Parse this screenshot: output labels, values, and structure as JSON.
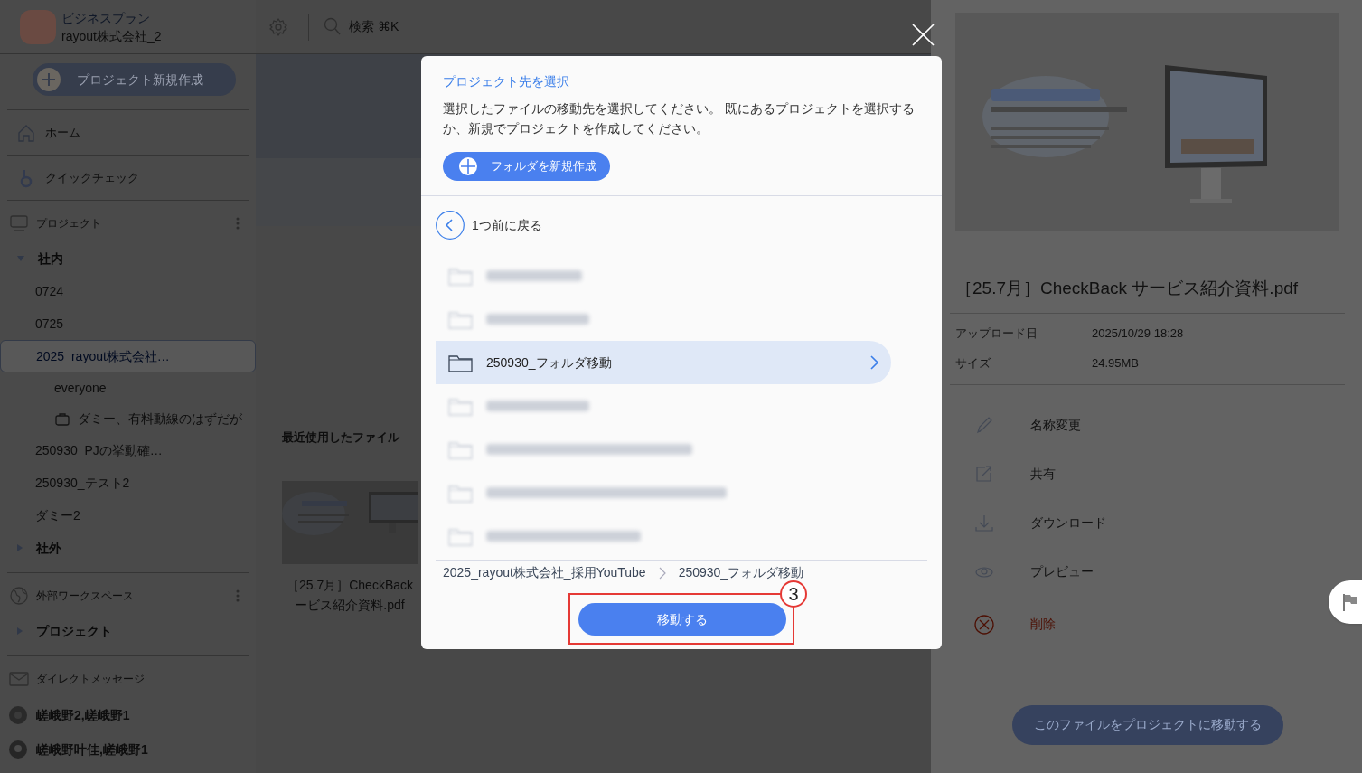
{
  "header": {
    "plan": "ビジネスプラン",
    "workspace": "rayout株式会社_2",
    "search": {
      "placeholder": "検索 ⌘K"
    }
  },
  "sidebar": {
    "new_project_button": "プロジェクト新規作成",
    "nav": [
      {
        "label": "ホーム",
        "kind": "home"
      },
      {
        "label": "クイックチェック",
        "kind": "quick"
      }
    ],
    "projects": {
      "title": "プロジェクト",
      "groups": [
        {
          "label": "社内",
          "expanded": true,
          "children": [
            {
              "label": "0724",
              "selected": false
            },
            {
              "label": "0725",
              "selected": false
            },
            {
              "label": "2025_rayout株式会社…",
              "selected": true,
              "children": [
                {
                  "label": "everyone",
                  "kind": "plain",
                  "selected": false
                },
                {
                  "label": "ダミー、有料動線のはずだが",
                  "kind": "locked",
                  "selected": false
                }
              ]
            },
            {
              "label": "250930_PJの挙動確…",
              "selected": false
            },
            {
              "label": "250930_テスト2",
              "selected": false
            },
            {
              "label": "ダミー2",
              "selected": false
            }
          ]
        },
        {
          "label": "社外",
          "expanded": false
        }
      ]
    },
    "external": {
      "title": "外部ワークスペース",
      "groups": [
        {
          "label": "プロジェクト",
          "expanded": false
        }
      ]
    },
    "messages": {
      "title": "ダイレクトメッセージ",
      "items": [
        {
          "label": "嵯峨野2,嵯峨野1",
          "kind": "initials"
        },
        {
          "label": "嵯峨野叶佳,嵯峨野1"
        }
      ]
    }
  },
  "main": {
    "recent_heading": "最近使用したファイル",
    "files": [
      {
        "name_lines": [
          "［25.7月］CheckBack",
          "ービス紹介資料.pdf"
        ]
      }
    ]
  },
  "detail": {
    "title": "［25.7月］CheckBack サービス紹介資料.pdf",
    "info": [
      {
        "label": "アップロード日",
        "value": "2025/10/29 18:28"
      },
      {
        "label": "サイズ",
        "value": "24.95MB"
      }
    ],
    "actions": [
      {
        "label": "名称変更",
        "kind": "rename"
      },
      {
        "label": "共有",
        "kind": "share"
      },
      {
        "label": "ダウンロード",
        "kind": "download"
      },
      {
        "label": "プレビュー",
        "kind": "preview"
      },
      {
        "label": "削除",
        "kind": "delete"
      }
    ],
    "move_button": "このファイルをプロジェクトに移動する"
  },
  "dialog": {
    "title": "プロジェクト先を選択",
    "description": "選択したファイルの移動先を選択してください。 既にあるプロジェクトを選択するか、新規でプロジェクトを作成してください。",
    "new_folder_button": "フォルダを新規作成",
    "back_label": "1つ前に戻る",
    "folders": [
      {
        "kind": "blurred",
        "selected": false
      },
      {
        "kind": "blurred",
        "selected": false
      },
      {
        "kind": "folder",
        "label": "250930_フォルダ移動",
        "selected": true
      },
      {
        "kind": "blurred",
        "selected": false
      },
      {
        "kind": "blurred",
        "selected": false
      },
      {
        "kind": "blurred",
        "selected": false
      },
      {
        "kind": "blurred",
        "selected": false
      }
    ],
    "breadcrumb": [
      "2025_rayout株式会社_採用YouTube",
      "250930_フォルダ移動"
    ],
    "move_button": "移動する",
    "step": "3"
  }
}
